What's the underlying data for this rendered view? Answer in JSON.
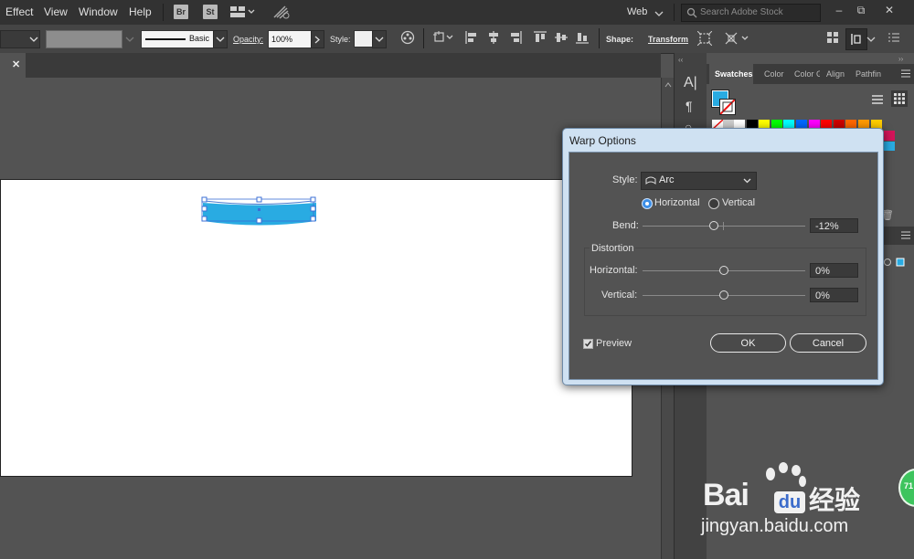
{
  "menubar": {
    "items": [
      "Effect",
      "View",
      "Window",
      "Help"
    ],
    "bridge_badge": "Br",
    "stock_badge": "St",
    "workspace": "Web",
    "search_placeholder": "Search Adobe Stock"
  },
  "control_bar": {
    "stroke_style": "Basic",
    "opacity_label": "Opacity:",
    "opacity_value": "100%",
    "style_label": "Style:",
    "shape_label": "Shape:",
    "transform_label": "Transform"
  },
  "panel": {
    "tabs": [
      "Swatches",
      "Color",
      "Color Guide",
      "Align",
      "Pathfinder"
    ],
    "swatch_colors": [
      "#ffffff",
      "#000000",
      "#ffff00",
      "#00ff00",
      "#00ffff",
      "#0066ff",
      "#ff00ff",
      "#ff0000",
      "#cc0000",
      "#ff6600",
      "#ff9900",
      "#ffcc00"
    ],
    "fill_color": "#29abe2"
  },
  "artwork": {
    "shape_color": "#29abe2"
  },
  "dialog": {
    "title": "Warp Options",
    "style_label": "Style:",
    "style_value": "Arc",
    "orientation_horizontal": "Horizontal",
    "orientation_vertical": "Vertical",
    "orientation_selected": "Horizontal",
    "bend_label": "Bend:",
    "bend_value": "-12%",
    "bend_fraction": 0.44,
    "distortion_label": "Distortion",
    "dist_horizontal_label": "Horizontal:",
    "dist_horizontal_value": "0%",
    "dist_vertical_label": "Vertical:",
    "dist_vertical_value": "0%",
    "preview_label": "Preview",
    "preview_checked": true,
    "ok_label": "OK",
    "cancel_label": "Cancel"
  },
  "watermark": {
    "brand": "Bai",
    "brand_suffix": "du",
    "brand_cn": "经验",
    "url": "jingyan.baidu.com"
  },
  "badge_number": "71"
}
